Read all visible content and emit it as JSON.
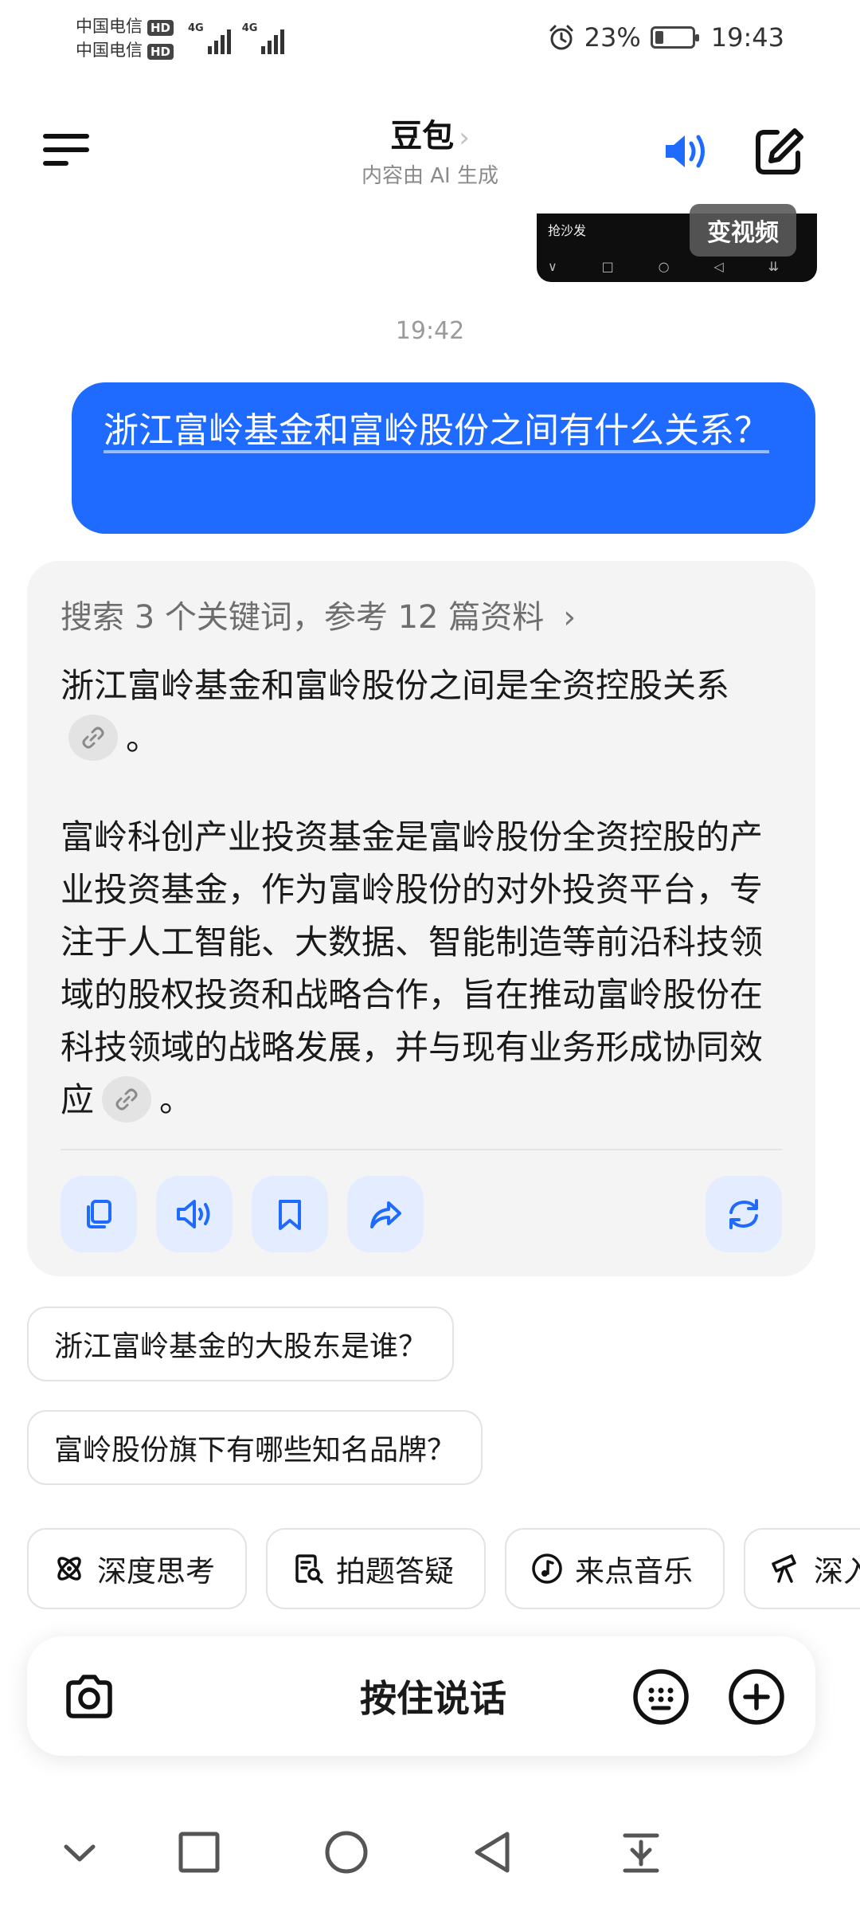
{
  "status_bar": {
    "carrier_1": "中国电信",
    "carrier_2": "中国电信",
    "hd": "HD",
    "network_1": "4G",
    "network_2": "4G",
    "battery_percent": "23%",
    "battery_level": 0.23,
    "time": "19:43"
  },
  "header": {
    "title": "豆包",
    "title_chevron": "›",
    "subtitle": "内容由 AI 生成",
    "icons": {
      "menu": "menu-icon",
      "speaker": "speaker-icon",
      "edit": "edit-icon"
    }
  },
  "video_preview": {
    "thumb_title": "抢沙发",
    "nav_glyphs": [
      "∨",
      "□",
      "○",
      "◁",
      "⇊"
    ],
    "chip_label": "变视频"
  },
  "timestamp": "19:42",
  "user_message": "浙江富岭基金和富岭股份之间有什么关系？",
  "answer": {
    "sources_label": "搜索 3 个关键词，参考 12 篇资料",
    "sources_chevron": "›",
    "paragraph_1": "浙江富岭基金和富岭股份之间是全资控股关系",
    "paragraph_1_end": "。",
    "paragraph_2": "富岭科创产业投资基金是富岭股份全资控股的产业投资基金，作为富岭股份的对外投资平台，专注于人工智能、大数据、智能制造等前沿科技领域的股权投资和战略合作，旨在推动富岭股份在科技领域的战略发展，并与现有业务形成协同效应",
    "paragraph_2_end": "。",
    "actions": [
      "copy-icon",
      "read-aloud-icon",
      "bookmark-icon",
      "share-icon",
      "regenerate-icon"
    ]
  },
  "suggestions": [
    "浙江富岭基金的大股东是谁？",
    "富岭股份旗下有哪些知名品牌？"
  ],
  "skills": [
    {
      "label": "深度思考",
      "icon": "atom-icon"
    },
    {
      "label": "拍题答疑",
      "icon": "photo-search-icon"
    },
    {
      "label": "来点音乐",
      "icon": "music-icon"
    },
    {
      "label": "深入研究",
      "icon": "telescope-icon"
    }
  ],
  "input": {
    "hold_to_talk": "按住说话",
    "icons": {
      "camera": "camera-icon",
      "keyboard": "keyboard-icon",
      "plus": "plus-icon"
    }
  },
  "nav_bar": {
    "icons": [
      "collapse-icon",
      "recents-icon",
      "home-icon",
      "back-icon",
      "notification-pull-icon"
    ]
  },
  "colors": {
    "accent": "#1f6bff",
    "card_bg": "#f4f4f4",
    "action_bg": "#e3edff",
    "text": "#1a1a1a",
    "muted": "#8a8a8a"
  }
}
